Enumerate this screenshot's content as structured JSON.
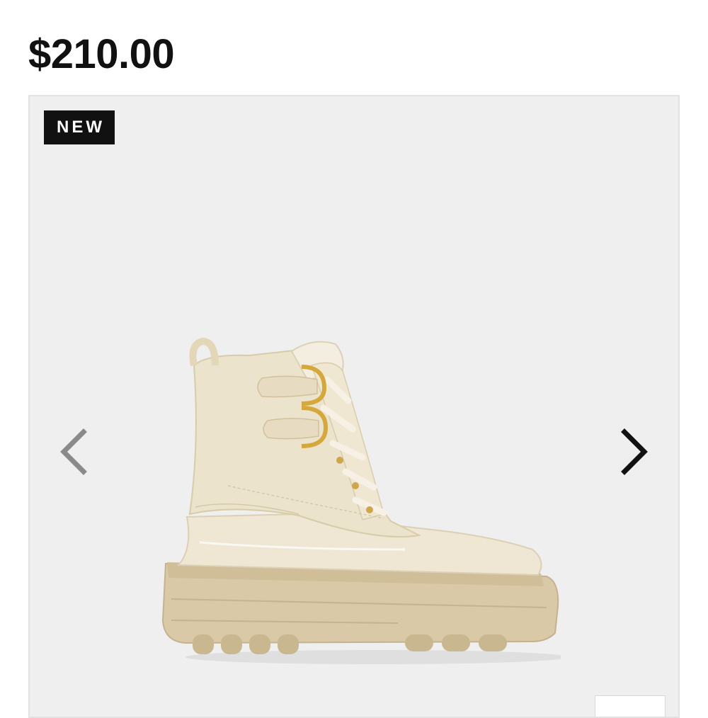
{
  "product": {
    "price": "$210.00",
    "badge": "NEW",
    "image_icon": "boot-product-image",
    "colors": {
      "badge_bg": "#111111",
      "badge_text": "#ffffff",
      "gallery_bg": "#efefef",
      "arrow_prev": "#8a8a8a",
      "arrow_next": "#111111"
    }
  },
  "carousel": {
    "prev_icon": "chevron-left-icon",
    "next_icon": "chevron-right-icon"
  }
}
